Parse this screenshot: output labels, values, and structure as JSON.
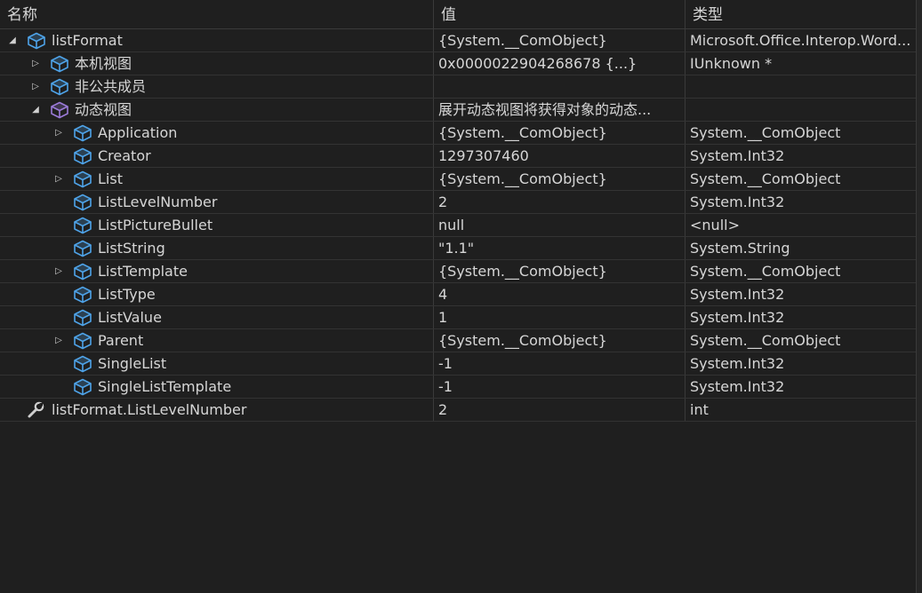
{
  "header": {
    "col_name": "名称",
    "col_value": "值",
    "col_type": "类型"
  },
  "rows": [
    {
      "name": "listFormat",
      "value": "{System.__ComObject}",
      "type": "Microsoft.Office.Interop.Word...",
      "level": 0,
      "expander": "expanded",
      "icon": "object-cube-icon"
    },
    {
      "name": "本机视图",
      "value": "0x0000022904268678 {...}",
      "type": "IUnknown *",
      "level": 1,
      "expander": "collapsed",
      "icon": "object-cube-icon"
    },
    {
      "name": "非公共成员",
      "value": "",
      "type": "",
      "level": 1,
      "expander": "collapsed",
      "icon": "object-cube-icon"
    },
    {
      "name": "动态视图",
      "value": "展开动态视图将获得对象的动态...",
      "type": "",
      "level": 1,
      "expander": "expanded",
      "icon": "dynamic-view-cube-icon"
    },
    {
      "name": "Application",
      "value": "{System.__ComObject}",
      "type": "System.__ComObject",
      "level": 2,
      "expander": "collapsed",
      "icon": "object-cube-icon"
    },
    {
      "name": "Creator",
      "value": "1297307460",
      "type": "System.Int32",
      "level": 2,
      "expander": "none",
      "icon": "object-cube-icon"
    },
    {
      "name": "List",
      "value": "{System.__ComObject}",
      "type": "System.__ComObject",
      "level": 2,
      "expander": "collapsed",
      "icon": "object-cube-icon"
    },
    {
      "name": "ListLevelNumber",
      "value": "2",
      "type": "System.Int32",
      "level": 2,
      "expander": "none",
      "icon": "object-cube-icon"
    },
    {
      "name": "ListPictureBullet",
      "value": "null",
      "type": "<null>",
      "level": 2,
      "expander": "none",
      "icon": "object-cube-icon"
    },
    {
      "name": "ListString",
      "value": "\"1.1\"",
      "type": "System.String",
      "level": 2,
      "expander": "none",
      "icon": "object-cube-icon"
    },
    {
      "name": "ListTemplate",
      "value": "{System.__ComObject}",
      "type": "System.__ComObject",
      "level": 2,
      "expander": "collapsed",
      "icon": "object-cube-icon"
    },
    {
      "name": "ListType",
      "value": "4",
      "type": "System.Int32",
      "level": 2,
      "expander": "none",
      "icon": "object-cube-icon"
    },
    {
      "name": "ListValue",
      "value": "1",
      "type": "System.Int32",
      "level": 2,
      "expander": "none",
      "icon": "object-cube-icon"
    },
    {
      "name": "Parent",
      "value": "{System.__ComObject}",
      "type": "System.__ComObject",
      "level": 2,
      "expander": "collapsed",
      "icon": "object-cube-icon"
    },
    {
      "name": "SingleList",
      "value": "-1",
      "type": "System.Int32",
      "level": 2,
      "expander": "none",
      "icon": "object-cube-icon"
    },
    {
      "name": "SingleListTemplate",
      "value": "-1",
      "type": "System.Int32",
      "level": 2,
      "expander": "none",
      "icon": "object-cube-icon"
    },
    {
      "name": "listFormat.ListLevelNumber",
      "value": "2",
      "type": "int",
      "level": 0,
      "expander": "none",
      "icon": "wrench-icon"
    }
  ],
  "colors": {
    "background": "#1f1f1f",
    "text": "#d6d6d6",
    "object_icon": "#4ea3e8",
    "dynamic_icon": "#9b7bd8",
    "accent": "#6b5fd6"
  }
}
